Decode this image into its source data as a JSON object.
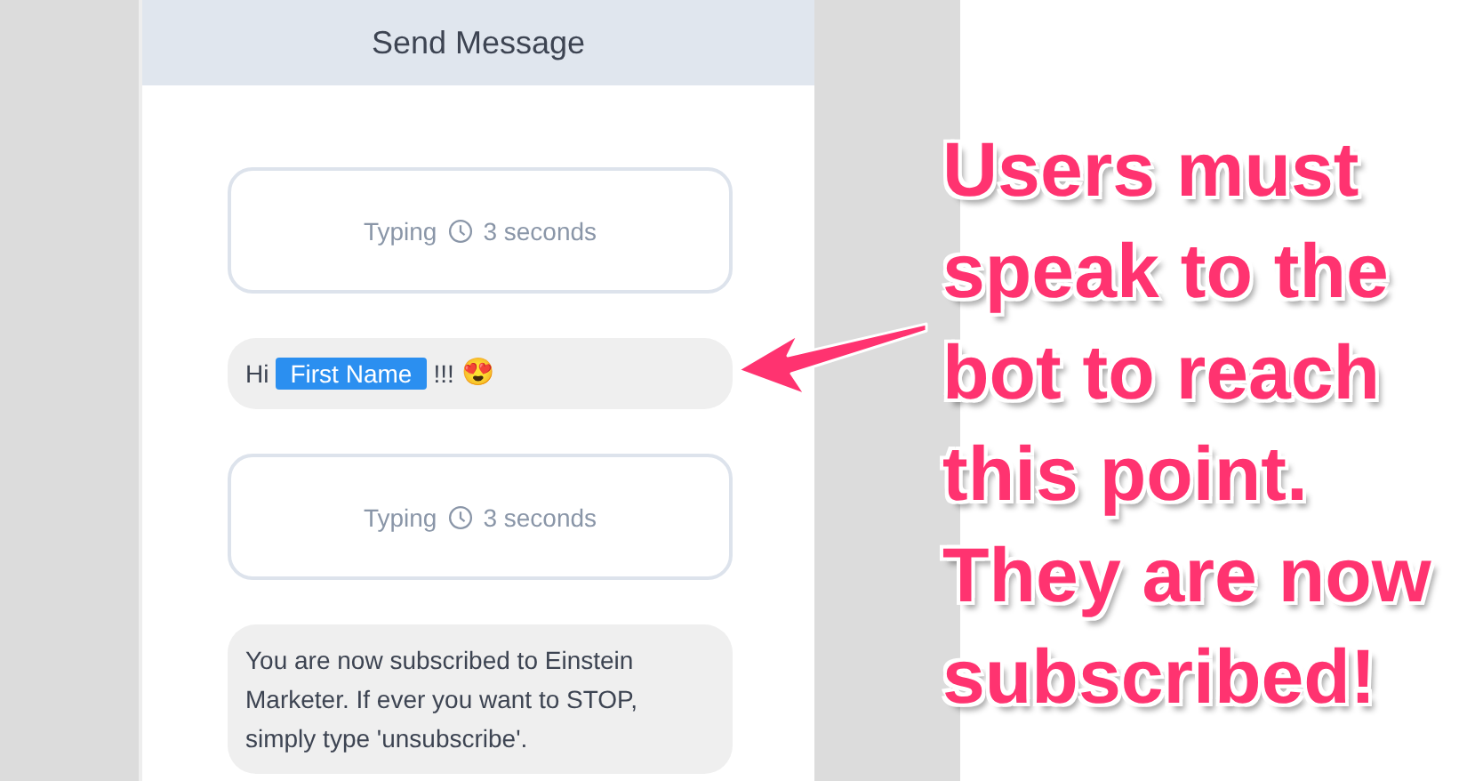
{
  "panel": {
    "title": "Send Message"
  },
  "messages": [
    {
      "kind": "typing",
      "label": "Typing",
      "duration": "3 seconds"
    },
    {
      "kind": "text",
      "parts": [
        {
          "kind": "text",
          "text": "Hi"
        },
        {
          "kind": "merge_field",
          "text": "First Name"
        },
        {
          "kind": "text",
          "text": "!!!"
        },
        {
          "kind": "emoji",
          "text": "😍"
        }
      ]
    },
    {
      "kind": "typing",
      "label": "Typing",
      "duration": "3 seconds"
    },
    {
      "kind": "text",
      "parts": [
        {
          "kind": "text",
          "text": "You are now subscribed to Einstein Marketer. If ever you want to STOP, simply type 'unsubscribe'."
        }
      ]
    }
  ],
  "annotation": {
    "text": "Users must speak to the bot to reach this point. They are now subscribed!"
  }
}
